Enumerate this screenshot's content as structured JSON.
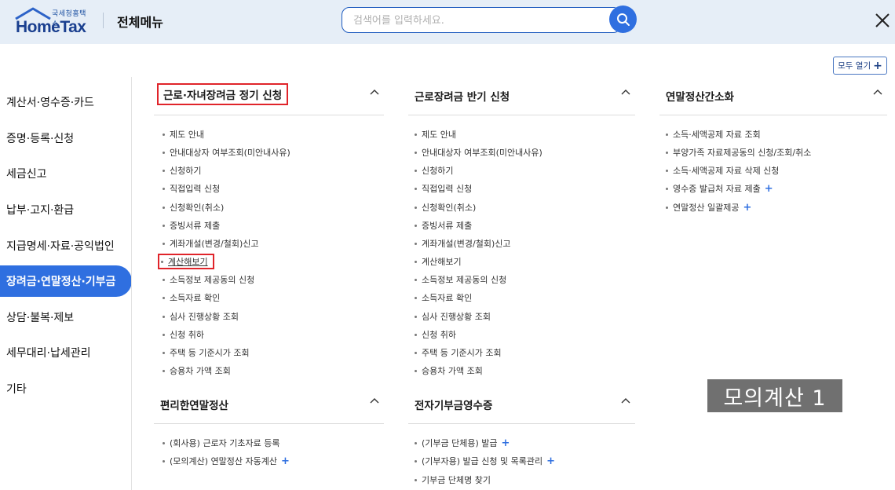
{
  "header": {
    "logo_sub": "국세청홈택스",
    "logo_main": "HomeTax",
    "title": "전체메뉴",
    "search_placeholder": "검색어를 입력하세요."
  },
  "expand_all": {
    "label": "모두 열기",
    "plus": "+"
  },
  "left_nav": [
    {
      "label": "계산서·영수증·카드",
      "active": false
    },
    {
      "label": "증명·등록·신청",
      "active": false
    },
    {
      "label": "세금신고",
      "active": false
    },
    {
      "label": "납부·고지·환급",
      "active": false
    },
    {
      "label": "지급명세·자료·공익법인",
      "active": false
    },
    {
      "label": "장려금·연말정산·기부금",
      "active": true
    },
    {
      "label": "상담·불복·제보",
      "active": false
    },
    {
      "label": "세무대리·납세관리",
      "active": false
    },
    {
      "label": "기타",
      "active": false
    }
  ],
  "sections": [
    {
      "title": "근로·자녀장려금 정기 신청",
      "items": [
        "제도 안내",
        "안내대상자 여부조회(미안내사유)",
        "신청하기",
        "직접입력 신청",
        "신청확인(취소)",
        "증빙서류 제출",
        "계좌개설(변경/철회)신고",
        "계산해보기",
        "소득정보 제공동의 신청",
        "소득자료 확인",
        "심사 진행상황 조회",
        "신청 취하",
        "주택 등 기준시가 조회",
        "승용차 가액 조회"
      ]
    },
    {
      "title": "근로장려금 반기 신청",
      "items": [
        "제도 안내",
        "안내대상자 여부조회(미안내사유)",
        "신청하기",
        "직접입력 신청",
        "신청확인(취소)",
        "증빙서류 제출",
        "계좌개설(변경/철회)신고",
        "계산해보기",
        "소득정보 제공동의 신청",
        "소득자료 확인",
        "심사 진행상황 조회",
        "신청 취하",
        "주택 등 기준시가 조회",
        "승용차 가액 조회"
      ]
    },
    {
      "title": "연말정산간소화",
      "items": [
        "소득·세액공제 자료 조회",
        "부양가족 자료제공동의 신청/조회/취소",
        "소득·세액공제 자료 삭제 신청",
        "영수증 발급처 자료 제출",
        "연말정산 일괄제공"
      ]
    },
    {
      "title": "편리한연말정산",
      "items": [
        "(회사용) 근로자 기초자료 등록",
        "(모의계산) 연말정산 자동계산"
      ]
    },
    {
      "title": "전자기부금영수증",
      "items": [
        "(기부금 단체용) 발급",
        "(기부자용) 발급 신청 및 목록관리",
        "기부금 단체명 찾기"
      ]
    }
  ],
  "more_plus": "+",
  "watermark": "모의계산 1",
  "colors": {
    "accent": "#2f6fe0",
    "highlight_box": "#e0242a",
    "header_bg": "#e6eef7"
  }
}
